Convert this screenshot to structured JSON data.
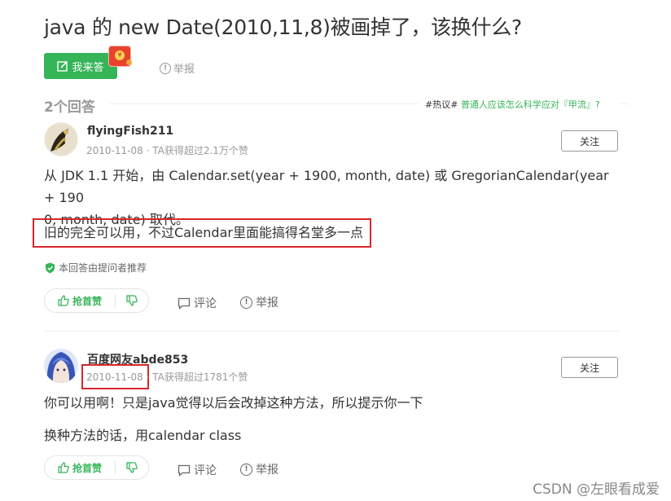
{
  "question": {
    "title": "java 的 new Date(2010,11,8)被画掉了，该换什么?",
    "answer_button": "我来答",
    "report": "举报",
    "redpack_glyph": "¥"
  },
  "answers_header": {
    "count": "2个回答",
    "hot_tag": "#热议#",
    "hot_link": "普通人应该怎么科学应对『甲流』?"
  },
  "answers": [
    {
      "username": "flyingFish211",
      "date": "2010-11-08",
      "stats": "· TA获得超过2.1万个赞",
      "follow": "关注",
      "line1": "从 JDK 1.1 开始，由 Calendar.set(year + 1900, month, date) 或 GregorianCalendar(year + 190",
      "line2": "0, month, date) 取代。",
      "line3": "旧的完全可以用，不过Calendar里面能搞得名堂多一点",
      "recommended": "本回答由提问者推荐",
      "like": "抢首赞",
      "comment": "评论",
      "report": "举报"
    },
    {
      "username": "百度网友abde853",
      "date": "2010-11-08",
      "stats": "· TA获得超过1781个赞",
      "follow": "关注",
      "line1": "你可以用啊！只是java觉得以后会改掉这种方法，所以提示你一下",
      "line2": "换种方法的话，用calendar class",
      "like": "抢首赞",
      "comment": "评论",
      "report": "举报"
    }
  ],
  "watermark": "CSDN @左眼看成爱",
  "colors": {
    "accent": "#35b558",
    "highlight_border": "#d9262a",
    "muted": "#999999"
  }
}
